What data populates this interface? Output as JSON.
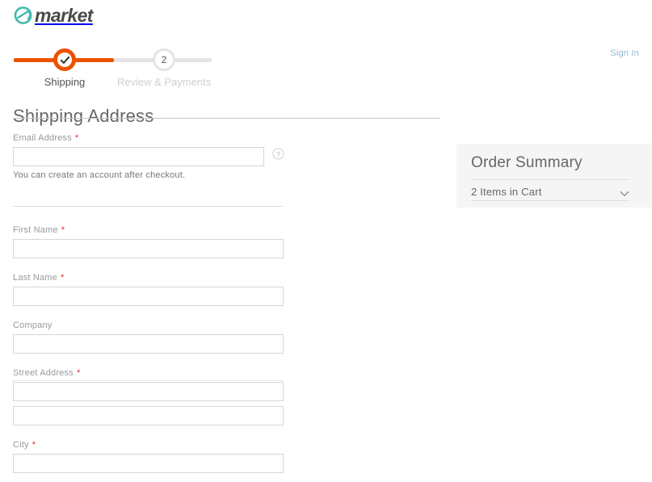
{
  "brand": {
    "name": "market",
    "mark": "e-circle-logo",
    "mark_color": "#46b9b0",
    "text_color": "#4a4a4a"
  },
  "header": {
    "sign_in_label": "Sign In",
    "sign_in_color": "#8fb8d6"
  },
  "progress": {
    "active_color": "#eb5202",
    "inactive_color": "#e4e4e4",
    "steps": [
      {
        "label": "Shipping",
        "number": "1",
        "state": "complete",
        "glyph": "check-icon"
      },
      {
        "label": "Review & Payments",
        "number": "2",
        "state": "upcoming"
      }
    ]
  },
  "shipping": {
    "title": "Shipping Address",
    "required_marker": "*",
    "email": {
      "label": "Email Address",
      "required": true,
      "value": "",
      "placeholder": "",
      "note": "You can create an account after checkout.",
      "tooltip_icon": "question-circle-icon"
    },
    "fields": [
      {
        "name": "first-name",
        "label": "First Name",
        "required": true,
        "value": "",
        "placeholder": ""
      },
      {
        "name": "last-name",
        "label": "Last Name",
        "required": true,
        "value": "",
        "placeholder": ""
      },
      {
        "name": "company",
        "label": "Company",
        "required": false,
        "value": "",
        "placeholder": ""
      },
      {
        "name": "street-address",
        "label": "Street Address",
        "required": true,
        "value": "",
        "placeholder": ""
      },
      {
        "name": "street-address-2",
        "label": "",
        "required": false,
        "value": "",
        "placeholder": ""
      },
      {
        "name": "city",
        "label": "City",
        "required": true,
        "value": "",
        "placeholder": ""
      }
    ]
  },
  "order_summary": {
    "title": "Order Summary",
    "items_row_label": "2 Items in Cart",
    "chevron_icon": "chevron-down-icon",
    "panel_bg": "#f5f5f5"
  }
}
